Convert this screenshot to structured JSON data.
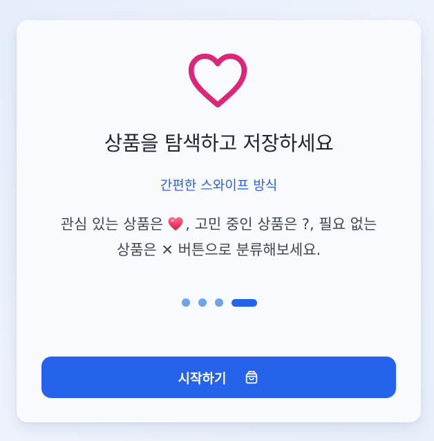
{
  "onboarding": {
    "icon": "heart-icon",
    "title": "상품을 탐색하고 저장하세요",
    "subtitle": "간편한 스와이프 방식",
    "description": {
      "part1": "관심 있는 상품은",
      "heart_emoji": "heart-emoji-icon",
      "part2": ", 고민 중인 상품은 ?, 필요 없는",
      "part3": "상품은 ✕ 버튼으로 분류해보세요."
    },
    "pagination": {
      "total": 4,
      "current": 4
    },
    "start_button": {
      "label": "시작하기",
      "icon": "shopping-bag-icon"
    }
  },
  "colors": {
    "accent": "#2563eb",
    "heart": "#db2777",
    "subtitle": "#2a62d8",
    "title": "#1f2533",
    "dot_inactive": "#6ea2ea"
  }
}
